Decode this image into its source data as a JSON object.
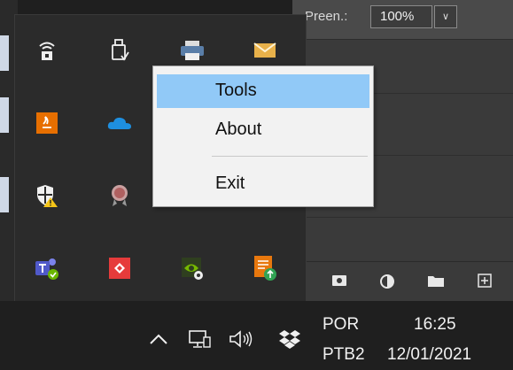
{
  "background_app": {
    "zoom_label": "Preen.:",
    "zoom_value": "100%"
  },
  "context_menu": {
    "items": [
      {
        "label": "Tools"
      },
      {
        "label": "About"
      },
      {
        "label": "Exit"
      }
    ]
  },
  "tray_icons": [
    "wifi-lock-icon",
    "usb-drive-icon",
    "printer-icon",
    "mail-icon",
    "java-icon",
    "onedrive-icon",
    "windows-security-icon",
    "cert-icon",
    "teams-icon",
    "remote-app-icon",
    "nvidia-icon",
    "office-upload-icon"
  ],
  "taskbar": {
    "language": "POR",
    "keyboard": "PTB2",
    "time": "16:25",
    "date": "12/01/2021"
  },
  "colors": {
    "menu_highlight": "#91c9f7",
    "taskbar_bg": "#1f1f1f",
    "flyout_bg": "#2b2b2b"
  }
}
